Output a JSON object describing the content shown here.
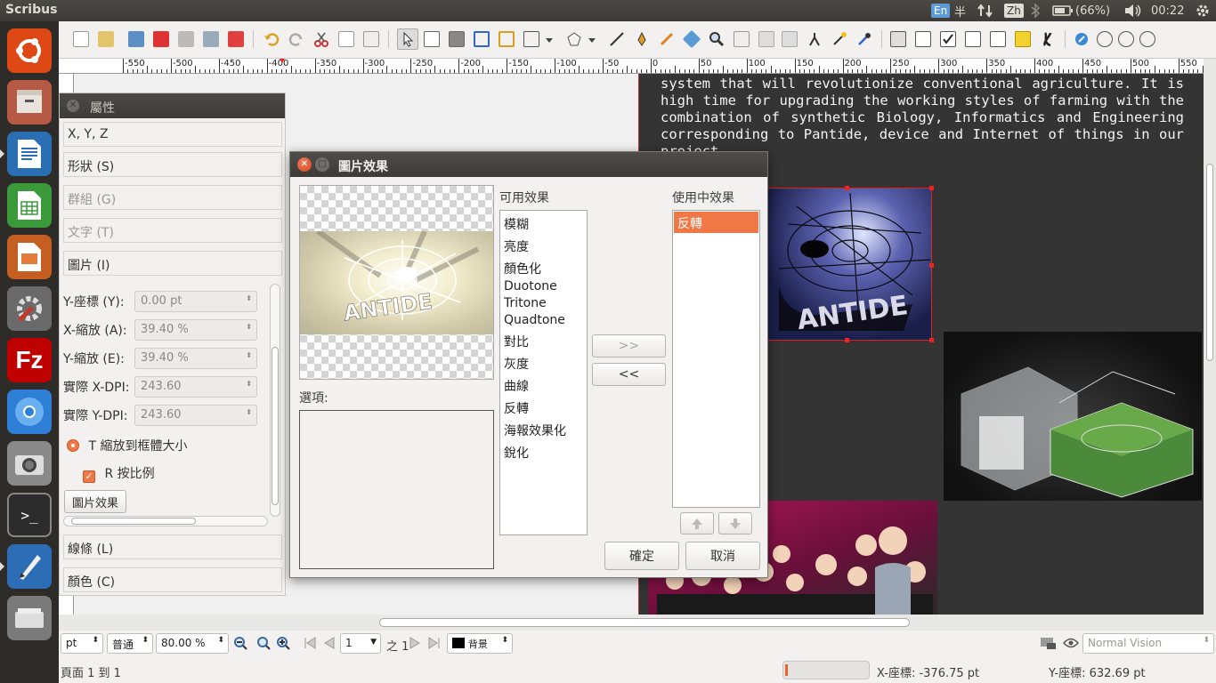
{
  "app": {
    "title": "Scribus"
  },
  "tray": {
    "kbd_en": "En",
    "kbd_half": "半",
    "kbd_zh": "Zh",
    "battery": "(66%)",
    "clock": "00:22"
  },
  "launcher": {
    "items": [
      {
        "name": "ubuntu-dash-icon"
      },
      {
        "name": "files-icon"
      },
      {
        "name": "writer-icon"
      },
      {
        "name": "calc-icon"
      },
      {
        "name": "impress-icon"
      },
      {
        "name": "settings-icon"
      },
      {
        "name": "filezilla-icon"
      },
      {
        "name": "chromium-icon"
      },
      {
        "name": "camera-icon"
      },
      {
        "name": "terminal-icon"
      },
      {
        "name": "scribus-icon"
      },
      {
        "name": "scanner-icon"
      }
    ]
  },
  "ruler": {
    "labels": [
      "-550",
      "-500",
      "-450",
      "-400",
      "-350",
      "-300",
      "-250",
      "-200",
      "-150",
      "-100",
      "-50",
      "0",
      "50",
      "100",
      "150",
      "200",
      "250",
      "300",
      "350",
      "400",
      "450",
      "500",
      "550"
    ]
  },
  "document": {
    "body_text": "system that will revolutionize conventional agriculture. It is high time for upgrading the working styles of farming with the combination of synthetic Biology, Informatics and Engineering corresponding to Pantide, device and Internet of things in our project."
  },
  "properties": {
    "title": "屬性",
    "sections": {
      "xyz": "X, Y, Z",
      "shape": "形狀 (S)",
      "group": "群組 (G)",
      "text": "文字 (T)",
      "image": "圖片 (I)",
      "line": "線條 (L)",
      "color": "顏色 (C)"
    },
    "fields": [
      {
        "label": "Y-座標 (Y):",
        "value": "0.00 pt"
      },
      {
        "label": "X-縮放 (A):",
        "value": "39.40 %"
      },
      {
        "label": "Y-縮放 (E):",
        "value": "39.40 %"
      },
      {
        "label": "實際 X-DPI:",
        "value": "243.60"
      },
      {
        "label": "實際 Y-DPI:",
        "value": "243.60"
      }
    ],
    "scale_to_frame": "T 縮放到框體大小",
    "keep_ratio": "R 按比例",
    "image_effects_button": "圖片效果"
  },
  "dialog": {
    "title": "圖片效果",
    "options_label": "選項:",
    "available_label": "可用效果",
    "in_use_label": "使用中效果",
    "available_effects": [
      "模糊",
      "亮度",
      "顏色化",
      "Duotone",
      "Tritone",
      "Quadtone",
      "對比",
      "灰度",
      "曲線",
      "反轉",
      "海報效果化",
      "銳化"
    ],
    "in_use_effects": [
      "反轉"
    ],
    "add_button": ">>",
    "remove_button": "<<",
    "ok_button": "確定",
    "cancel_button": "取消",
    "selection_color": "#f07746"
  },
  "statusbar": {
    "unit": "pt",
    "mode": "普通",
    "zoom": "80.00 %",
    "page_number": "1",
    "page_of": "之 1",
    "layer": "背景",
    "vision": "Normal Vision",
    "page_info": "頁面 1 到 1",
    "x_coord": "X-座標: -376.75 pt",
    "y_coord": "Y-座標: 632.69 pt"
  }
}
